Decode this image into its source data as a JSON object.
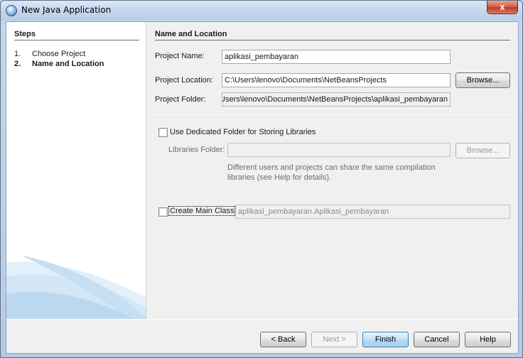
{
  "window": {
    "title": "New Java Application",
    "close_glyph": "x"
  },
  "steps": {
    "title": "Steps",
    "items": [
      {
        "num": "1.",
        "label": "Choose Project"
      },
      {
        "num": "2.",
        "label": "Name and Location"
      }
    ]
  },
  "main": {
    "title": "Name and Location",
    "project_name": {
      "label": "Project Name:",
      "value": "aplikasi_pembayaran"
    },
    "project_location": {
      "label": "Project Location:",
      "value": "C:\\Users\\lenovo\\Documents\\NetBeansProjects",
      "browse_label": "Browse..."
    },
    "project_folder": {
      "label": "Project Folder:",
      "value": "\\Users\\lenovo\\Documents\\NetBeansProjects\\aplikasi_pembayaran"
    },
    "dedicated_folder": {
      "label": "Use Dedicated Folder for Storing Libraries",
      "checked": false
    },
    "libraries_folder": {
      "label": "Libraries Folder:",
      "value": "",
      "browse_label": "Browse..."
    },
    "help_text": "Different users and projects can share the same compilation libraries (see Help for details).",
    "main_class": {
      "label": "Create Main Class",
      "checked": false,
      "value": "aplikasi_pembayaran.Aplikasi_pembayaran"
    }
  },
  "footer": {
    "back_label": "< Back",
    "next_label": "Next >",
    "finish_label": "Finish",
    "cancel_label": "Cancel",
    "help_label": "Help"
  },
  "colors": {
    "accent": "#3c7fb1",
    "swoosh": "#c6dff2"
  },
  "icons": {
    "title": "netbeans-cube-icon",
    "close": "close-icon"
  }
}
